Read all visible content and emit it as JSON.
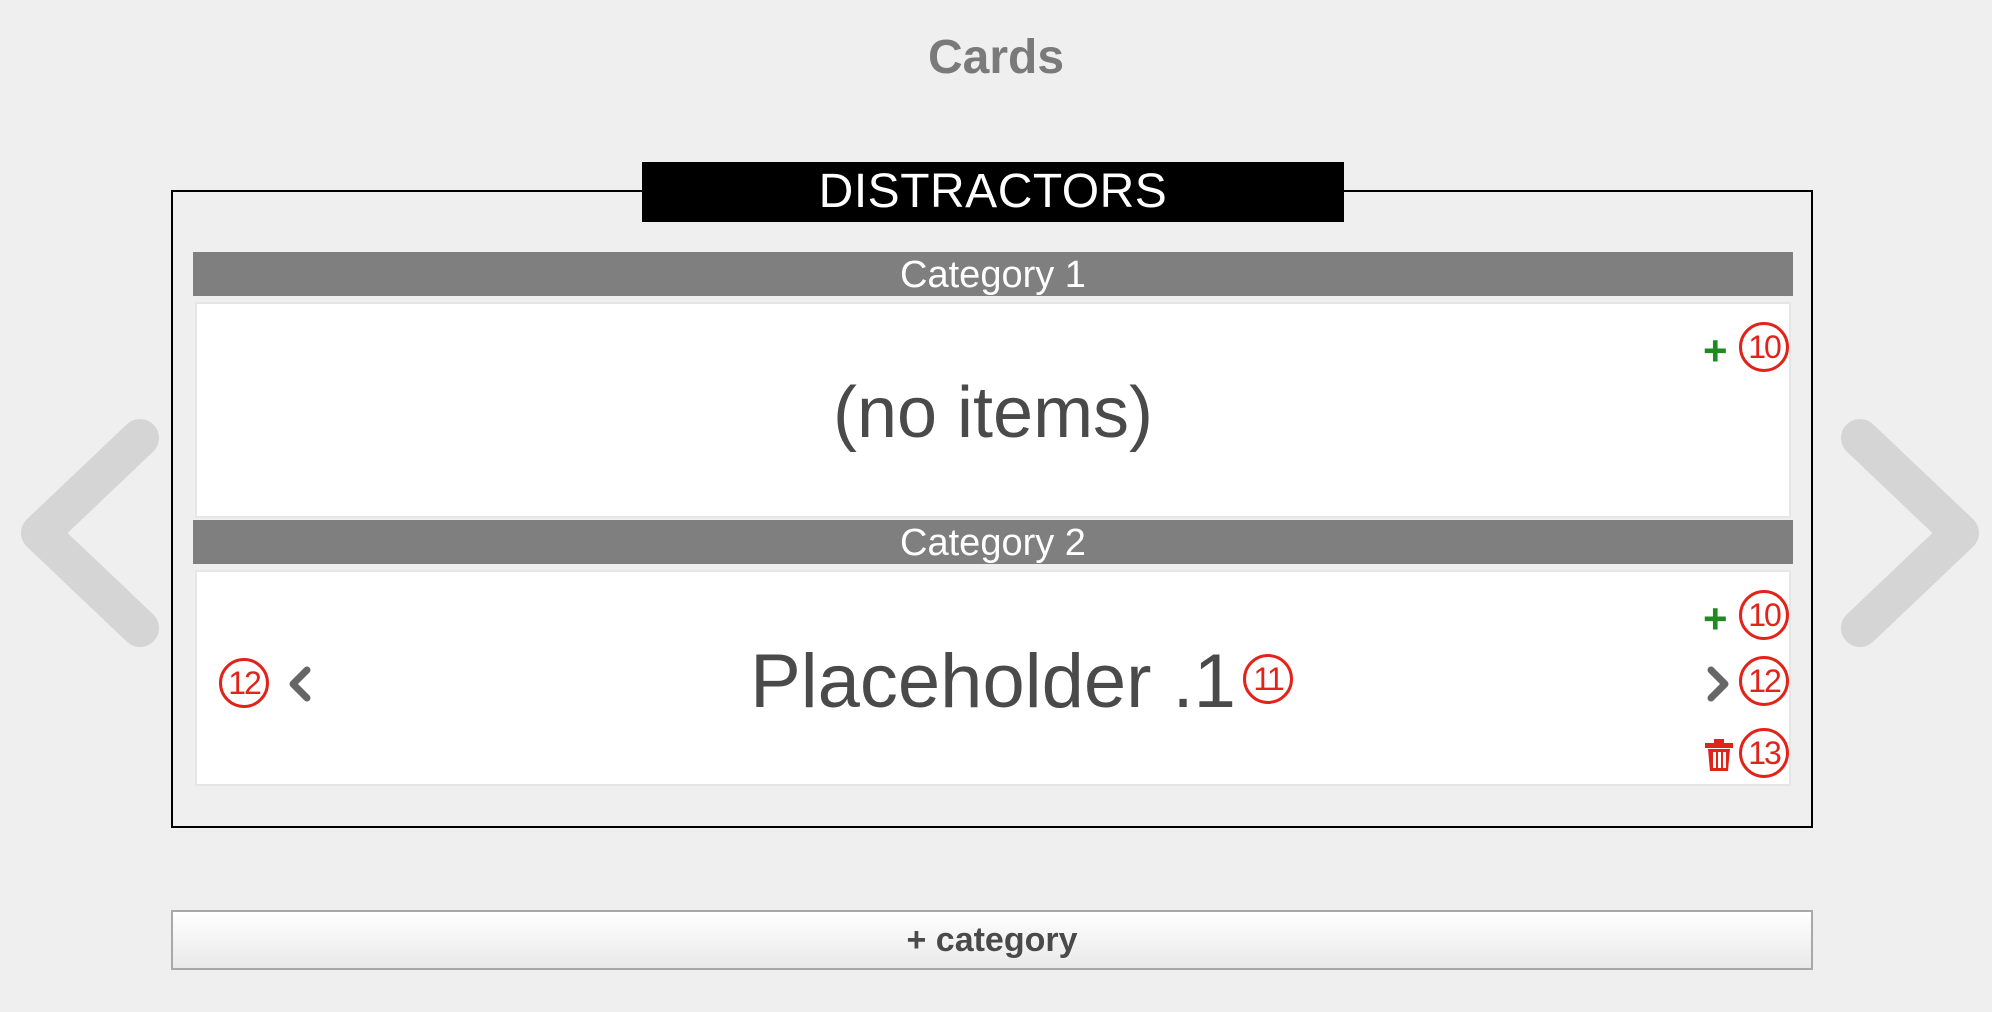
{
  "page": {
    "title": "Cards"
  },
  "nav": {
    "prev_icon": "chevron-left-icon",
    "next_icon": "chevron-right-icon"
  },
  "section": {
    "title": "DISTRACTORS"
  },
  "categories": [
    {
      "header": "Category 1",
      "content": "(no items)",
      "add_marker": "10"
    },
    {
      "header": "Category 2",
      "content": "Placeholder .1",
      "content_marker": "11",
      "add_marker": "10",
      "prev_marker": "12",
      "next_marker": "12",
      "delete_marker": "13"
    }
  ],
  "controls": {
    "add_symbol": "+"
  },
  "footer": {
    "add_category_label": "+ category"
  },
  "colors": {
    "background": "#efefef",
    "header_bg": "#7f7f7f",
    "title_bg": "#000000",
    "add_green": "#1f8a1f",
    "marker_red": "#e2231a",
    "trash_red": "#e2231a"
  }
}
